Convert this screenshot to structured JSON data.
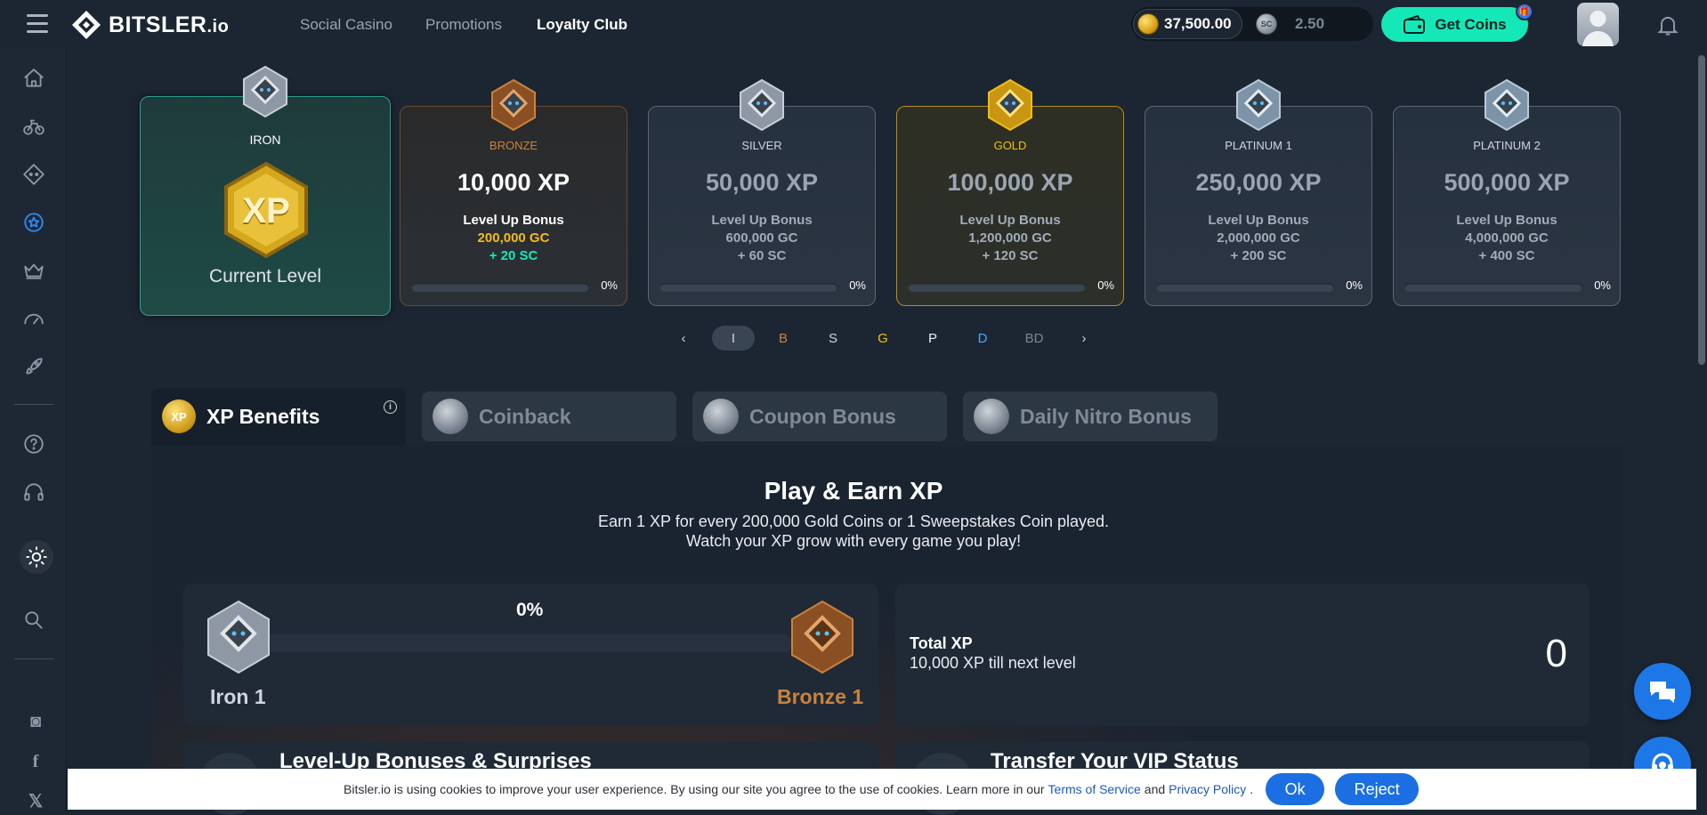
{
  "header": {
    "logo_text": "BITSLER",
    "logo_suffix": ".io",
    "nav": [
      "Social Casino",
      "Promotions",
      "Loyalty Club"
    ],
    "gc_balance": "37,500.00",
    "sc_badge": "SC",
    "sc_balance": "2.50",
    "get_coins": "Get Coins"
  },
  "tiers": [
    {
      "name": "IRON",
      "badge_text": "XP",
      "current": "Current Level",
      "color": "#cfd5dc"
    },
    {
      "name": "BRONZE",
      "xp": "10,000 XP",
      "bonus_label": "Level Up Bonus",
      "gc": "200,000 GC",
      "sc": "+ 20 SC",
      "pct": "0%",
      "color": "#c9823e"
    },
    {
      "name": "SILVER",
      "xp": "50,000 XP",
      "bonus_label": "Level Up Bonus",
      "gc": "600,000 GC",
      "sc": "+ 60 SC",
      "pct": "0%",
      "color": "#cfd5dc"
    },
    {
      "name": "GOLD",
      "xp": "100,000 XP",
      "bonus_label": "Level Up Bonus",
      "gc": "1,200,000 GC",
      "sc": "+ 120 SC",
      "pct": "0%",
      "color": "#f2be14"
    },
    {
      "name": "PLATINUM 1",
      "xp": "250,000 XP",
      "bonus_label": "Level Up Bonus",
      "gc": "2,000,000 GC",
      "sc": "+ 200 SC",
      "pct": "0%",
      "color": "#cfd5dc"
    },
    {
      "name": "PLATINUM 2",
      "xp": "500,000 XP",
      "bonus_label": "Level Up Bonus",
      "gc": "4,000,000 GC",
      "sc": "+ 400 SC",
      "pct": "0%",
      "color": "#cfd5dc"
    }
  ],
  "pager": {
    "prev": "‹",
    "next": "›",
    "items": [
      {
        "label": "I",
        "color": "#cfd5dc"
      },
      {
        "label": "B",
        "color": "#c9823e"
      },
      {
        "label": "S",
        "color": "#cfd5dc"
      },
      {
        "label": "G",
        "color": "#f2be14"
      },
      {
        "label": "P",
        "color": "#e8ecf0"
      },
      {
        "label": "D",
        "color": "#4aa8f0"
      },
      {
        "label": "BD",
        "color": "#7c8693"
      }
    ]
  },
  "tabs": [
    "XP Benefits",
    "Coinback",
    "Coupon Bonus",
    "Daily Nitro Bonus"
  ],
  "panel": {
    "title": "Play & Earn XP",
    "sub1": "Earn 1 XP for every 200,000 Gold Coins or 1 Sweepstakes Coin played.",
    "sub2": "Watch your XP grow with every game you play!",
    "progress_pct": "0%",
    "progress_value": 0,
    "from_level": "Iron 1",
    "to_level": "Bronze 1",
    "total_xp_label": "Total XP",
    "till_next": "10,000 XP till next level",
    "total_xp_value": "0",
    "card3_title": "Level-Up Bonuses & Surprises",
    "card4_title": "Transfer Your VIP Status"
  },
  "cookie": {
    "text": "Bitsler.io is using cookies to improve your user experience. By using our site you agree to the use of cookies. Learn more in our",
    "terms": "Terms of Service",
    "and": "and",
    "privacy": "Privacy Policy",
    "dot": ".",
    "ok": "Ok",
    "reject": "Reject"
  },
  "colors": {
    "accent_green": "#14e8b9",
    "accent_blue": "#1b6fe3",
    "bronze": "#c9823e",
    "gold": "#f2be14",
    "sc_green": "#14e8b9"
  }
}
